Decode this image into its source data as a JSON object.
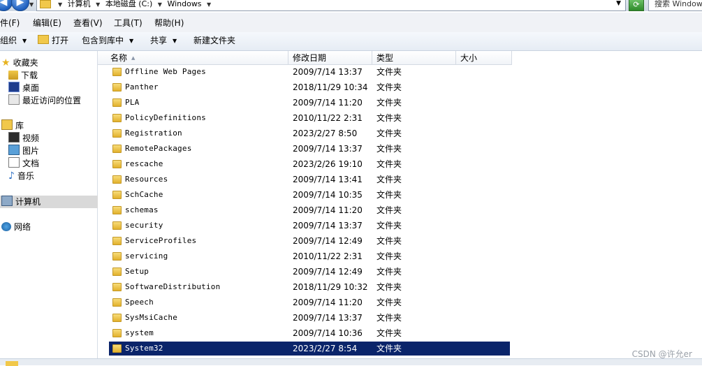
{
  "address": {
    "crumbs": [
      "计算机",
      "本地磁盘 (C:)",
      "Windows"
    ],
    "search_placeholder": "搜索 Windows"
  },
  "menu": [
    "件(F)",
    "编辑(E)",
    "查看(V)",
    "工具(T)",
    "帮助(H)"
  ],
  "toolbar": {
    "organize": "组织",
    "open": "打开",
    "include": "包含到库中",
    "share": "共享",
    "new_folder": "新建文件夹"
  },
  "nav": {
    "favorites": "收藏夹",
    "downloads": "下载",
    "desktop": "桌面",
    "recent": "最近访问的位置",
    "libraries": "库",
    "videos": "视频",
    "pictures": "图片",
    "documents": "文档",
    "music": "音乐",
    "computer": "计算机",
    "network": "网络"
  },
  "columns": {
    "name": "名称",
    "date": "修改日期",
    "type": "类型",
    "size": "大小"
  },
  "files": [
    {
      "name": "Offline Web Pages",
      "date": "2009/7/14 13:37",
      "type": "文件夹"
    },
    {
      "name": "Panther",
      "date": "2018/11/29 10:34",
      "type": "文件夹"
    },
    {
      "name": "PLA",
      "date": "2009/7/14 11:20",
      "type": "文件夹"
    },
    {
      "name": "PolicyDefinitions",
      "date": "2010/11/22 2:31",
      "type": "文件夹"
    },
    {
      "name": "Registration",
      "date": "2023/2/27 8:50",
      "type": "文件夹"
    },
    {
      "name": "RemotePackages",
      "date": "2009/7/14 13:37",
      "type": "文件夹"
    },
    {
      "name": "rescache",
      "date": "2023/2/26 19:10",
      "type": "文件夹"
    },
    {
      "name": "Resources",
      "date": "2009/7/14 13:41",
      "type": "文件夹"
    },
    {
      "name": "SchCache",
      "date": "2009/7/14 10:35",
      "type": "文件夹"
    },
    {
      "name": "schemas",
      "date": "2009/7/14 11:20",
      "type": "文件夹"
    },
    {
      "name": "security",
      "date": "2009/7/14 13:37",
      "type": "文件夹"
    },
    {
      "name": "ServiceProfiles",
      "date": "2009/7/14 12:49",
      "type": "文件夹"
    },
    {
      "name": "servicing",
      "date": "2010/11/22 2:31",
      "type": "文件夹"
    },
    {
      "name": "Setup",
      "date": "2009/7/14 12:49",
      "type": "文件夹"
    },
    {
      "name": "SoftwareDistribution",
      "date": "2018/11/29 10:32",
      "type": "文件夹"
    },
    {
      "name": "Speech",
      "date": "2009/7/14 11:20",
      "type": "文件夹"
    },
    {
      "name": "SysMsiCache",
      "date": "2009/7/14 13:37",
      "type": "文件夹"
    },
    {
      "name": "system",
      "date": "2009/7/14 10:36",
      "type": "文件夹"
    },
    {
      "name": "System32",
      "date": "2023/2/27 8:54",
      "type": "文件夹",
      "selected": true
    }
  ],
  "watermark": "CSDN @许允er",
  "colors": {
    "selection": "#0a246a",
    "folder": "#f1c84a"
  }
}
